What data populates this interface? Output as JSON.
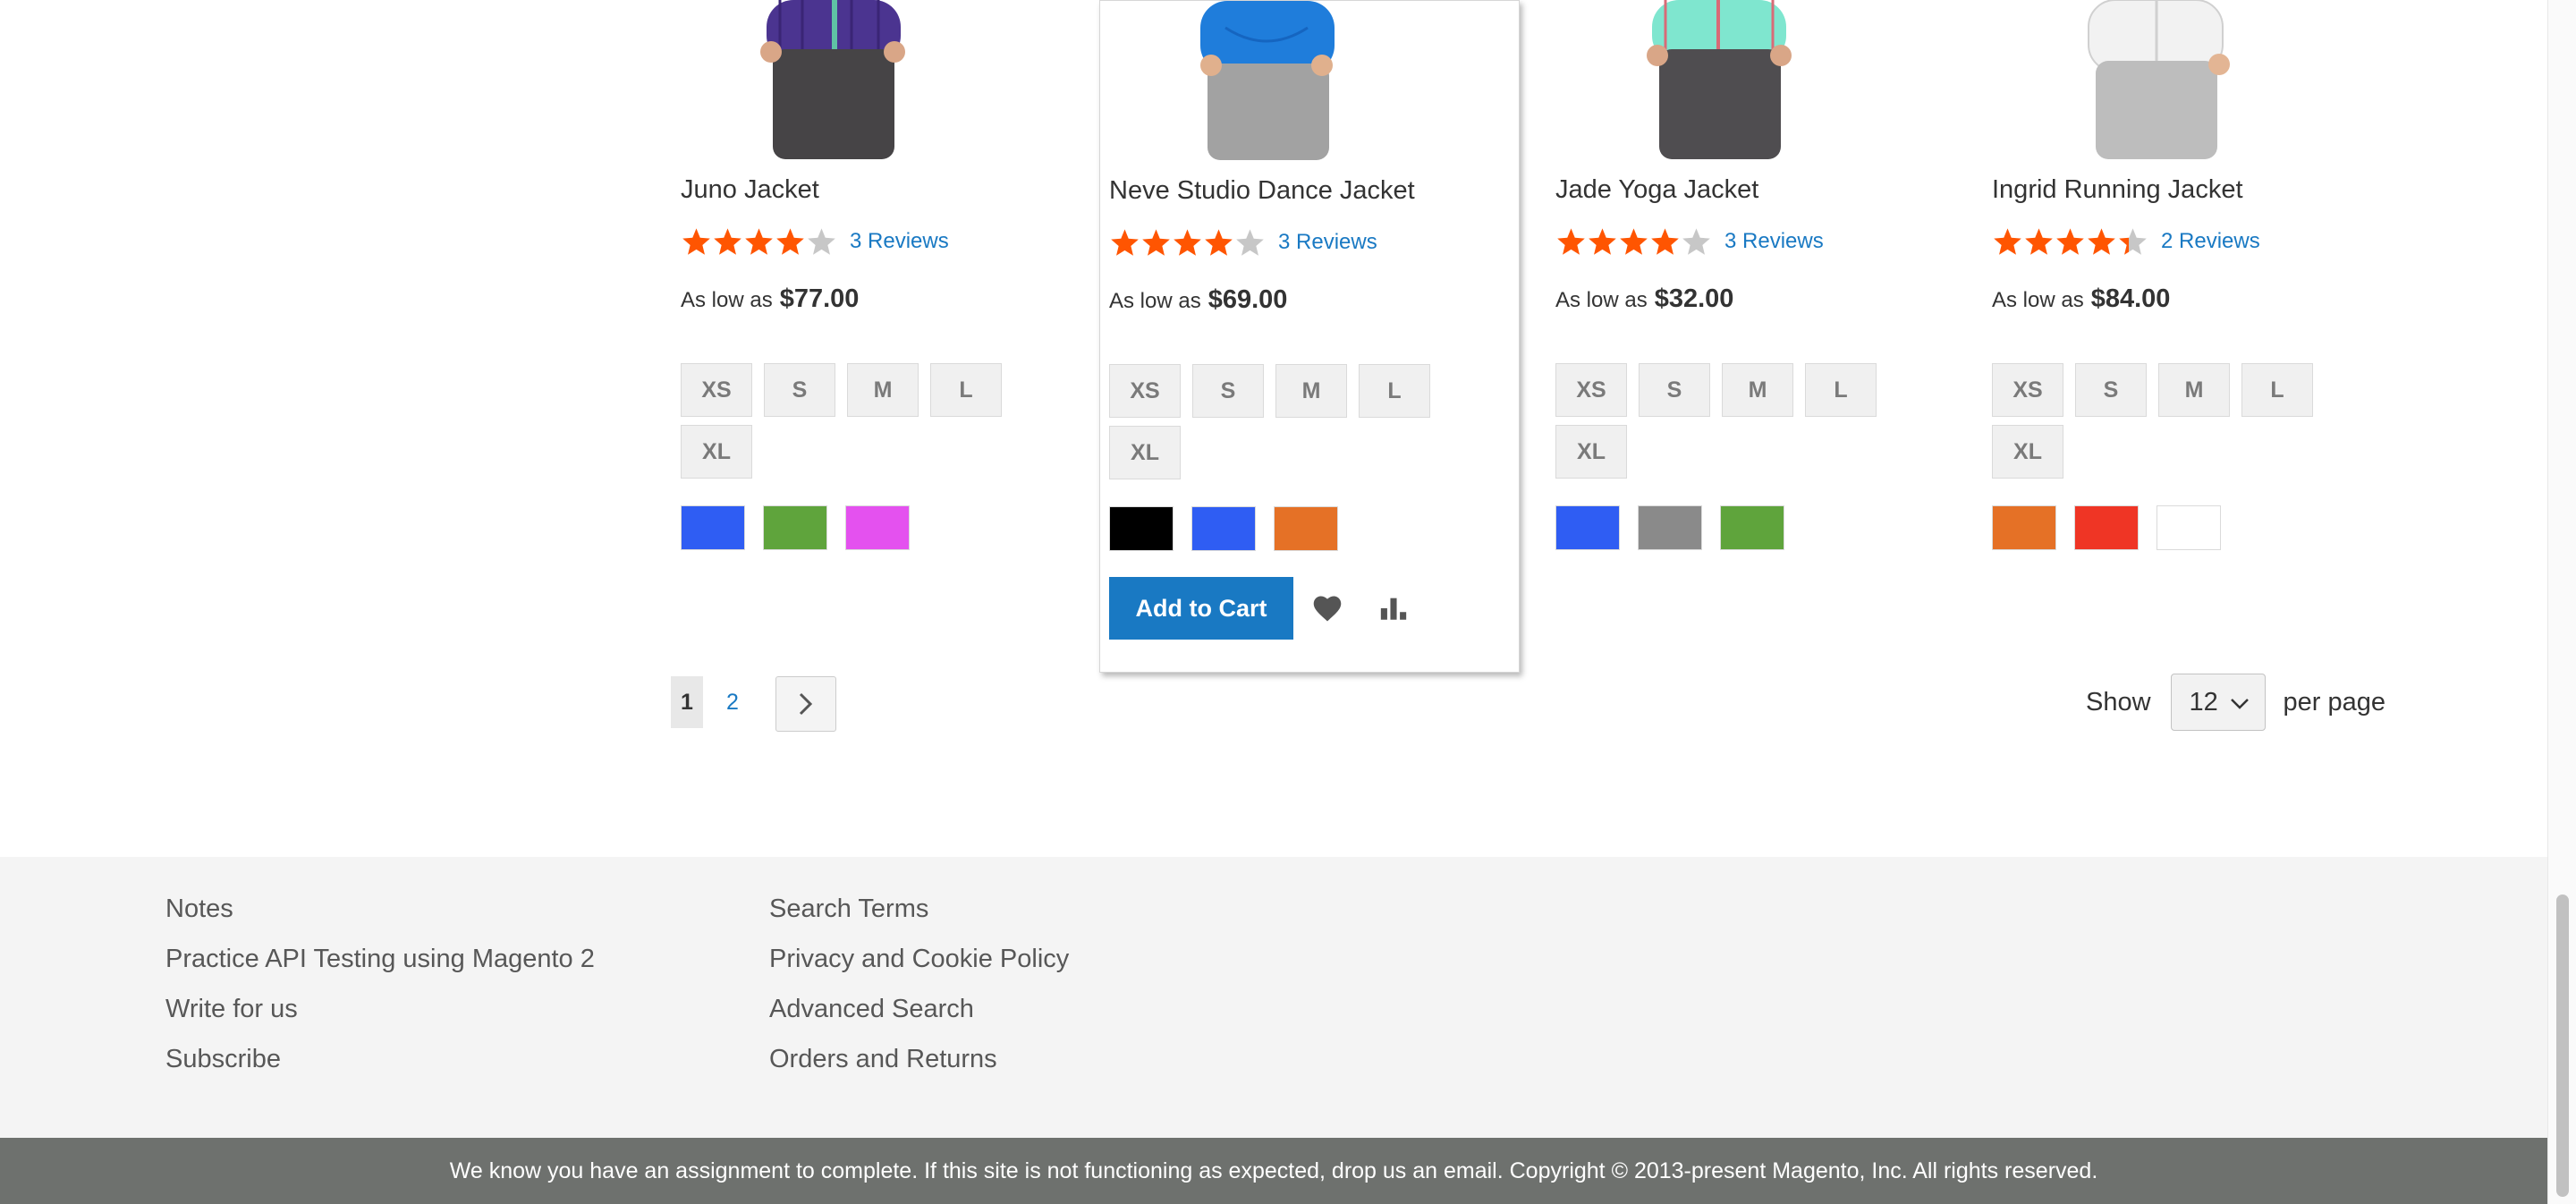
{
  "products": [
    {
      "name": "Juno Jacket",
      "rating_percent": 80,
      "reviews": "3 Reviews",
      "price_label": "As low as",
      "price": "$77.00",
      "sizes": [
        "XS",
        "S",
        "M",
        "L",
        "XL"
      ],
      "colors": [
        "#2f5df3",
        "#5fa43c",
        "#e451ef"
      ],
      "image": {
        "top": "#4b3490",
        "bottom": "#464446",
        "accent": "#5fc3a5"
      }
    },
    {
      "name": "Neve Studio Dance Jacket",
      "rating_percent": 80,
      "reviews": "3 Reviews",
      "price_label": "As low as",
      "price": "$69.00",
      "sizes": [
        "XS",
        "S",
        "M",
        "L",
        "XL"
      ],
      "colors": [
        "#000000",
        "#2f5df3",
        "#e57126"
      ],
      "image": {
        "top": "#1f7ddb",
        "bottom": "#a2a2a2",
        "accent": "#1565c0"
      }
    },
    {
      "name": "Jade Yoga Jacket",
      "rating_percent": 80,
      "reviews": "3 Reviews",
      "price_label": "As low as",
      "price": "$32.00",
      "sizes": [
        "XS",
        "S",
        "M",
        "L",
        "XL"
      ],
      "colors": [
        "#2f5df3",
        "#8a8a8a",
        "#5fa43c"
      ],
      "image": {
        "top": "#7fe6cf",
        "bottom": "#4f4d50",
        "accent": "#d86b77"
      }
    },
    {
      "name": "Ingrid Running Jacket",
      "rating_percent": 87,
      "reviews": "2 Reviews",
      "price_label": "As low as",
      "price": "$84.00",
      "sizes": [
        "XS",
        "S",
        "M",
        "L",
        "XL"
      ],
      "colors": [
        "#e57126",
        "#ef3525",
        "#ffffff"
      ],
      "image": {
        "top": "#f2f2f2",
        "bottom": "#bdbdbd",
        "accent": "#d0d0d0"
      }
    }
  ],
  "hovered_actions": {
    "add_to_cart": "Add to Cart",
    "wishlist_icon": "heart-icon",
    "compare_icon": "bar-chart-icon"
  },
  "pager": {
    "current": "1",
    "pages": [
      "2"
    ],
    "next_icon": "chevron-right-icon"
  },
  "limiter": {
    "show_label": "Show",
    "value": "12",
    "per_page_label": "per page"
  },
  "footer": {
    "col1": [
      "Notes",
      "Practice API Testing using Magento 2",
      "Write for us",
      "Subscribe"
    ],
    "col2": [
      "Search Terms",
      "Privacy and Cookie Policy",
      "Advanced Search",
      "Orders and Returns"
    ]
  },
  "copyright": "We know you have an assignment to complete. If this site is not functioning as expected, drop us an email. Copyright © 2013-present Magento, Inc. All rights reserved.",
  "colors": {
    "star": "#ff5501",
    "star_empty": "#c7c7c7",
    "link": "#1979c3",
    "primary_button": "#1979c3"
  }
}
